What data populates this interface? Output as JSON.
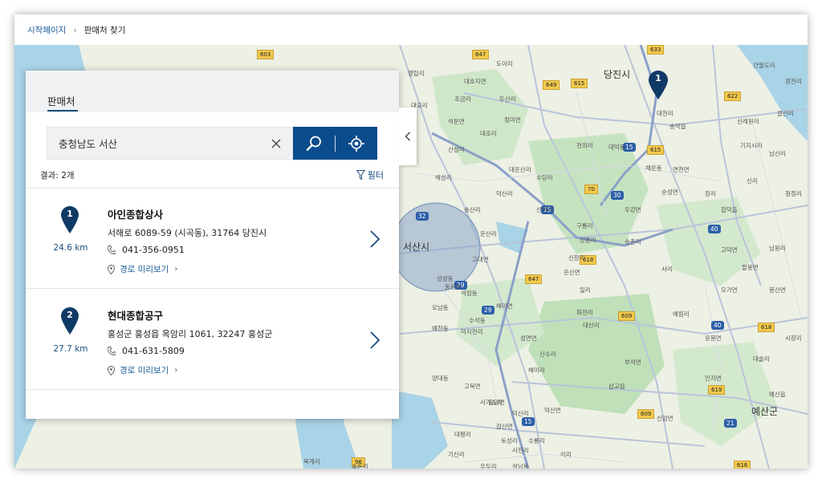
{
  "breadcrumb": {
    "home": "시작페이지",
    "separator": "›",
    "current": "판매처 찾기"
  },
  "panel": {
    "tab_label": "판매처",
    "search": {
      "value": "충청남도 서산",
      "placeholder": ""
    },
    "results_label": "결과: 2개",
    "filter_label": "필터",
    "collapse_icon": "chevron-left-icon"
  },
  "results": [
    {
      "number": "1",
      "name": "아인종합상사",
      "address": "서해로 6089-59 (시곡동), 31764 당진시",
      "phone": "041-356-0951",
      "distance": "24.6 km",
      "route_label": "경로 미리보기",
      "route_chevron": "›"
    },
    {
      "number": "2",
      "name": "현대종합공구",
      "address": "홍성군 홍성읍 옥암리 1061, 32247 홍성군",
      "phone": "041-631-5809",
      "distance": "27.7 km",
      "route_label": "경로 미리보기",
      "route_chevron": "›"
    }
  ],
  "map": {
    "cities": [
      "당진시",
      "서산시",
      "예산군"
    ],
    "marker_number": "1",
    "road_badges": [
      "603",
      "647",
      "649",
      "615",
      "633",
      "622",
      "615",
      "70",
      "618",
      "647",
      "609",
      "619",
      "609",
      "96",
      "618",
      "616"
    ],
    "highway_badges": [
      "15",
      "30",
      "15",
      "32",
      "29",
      "29",
      "15",
      "40",
      "40",
      "21"
    ],
    "places": [
      "영탑리",
      "대호지면",
      "도이리",
      "대요리",
      "조금리",
      "두산리",
      "석문면",
      "정미면",
      "산성리",
      "대조리",
      "해성리",
      "대운산리",
      "수당리",
      "천의리",
      "덕산리",
      "신평리",
      "일리",
      "우강면",
      "면천면",
      "순성면",
      "합덕읍",
      "고대면",
      "운산면",
      "신창리",
      "해미면",
      "성연면",
      "대산리",
      "고북면",
      "음암면",
      "갈산면",
      "덕산면",
      "삽교읍",
      "신암면",
      "오가면",
      "예산읍",
      "응봉면",
      "고덕면",
      "봉산면",
      "구룡리",
      "사기소리",
      "채운동",
      "대덕동",
      "송악읍",
      "기지시리",
      "남산리",
      "신리",
      "청정리",
      "양대동",
      "덕지천리",
      "상성동",
      "동문동",
      "석림동",
      "수석동",
      "오남동",
      "예천동",
      "갈산리",
      "해미리",
      "산수리",
      "덕산리",
      "사천리",
      "이리",
      "대천리",
      "신례원리",
      "남원리",
      "시장리",
      "예림리",
      "화천리",
      "운산리",
      "송산리",
      "상흥리",
      "송촌리",
      "사리",
      "팔봉면",
      "인지면",
      "부석면",
      "토성리",
      "수룡리",
      "기산리",
      "대평리",
      "우두리",
      "석남동",
      "장리",
      "간월도리",
      "광천리",
      "호동리",
      "목계리",
      "대술리"
    ]
  },
  "colors": {
    "accent": "#0b4c8c",
    "link": "#1a5d9a",
    "pin": "#0f3a66"
  }
}
